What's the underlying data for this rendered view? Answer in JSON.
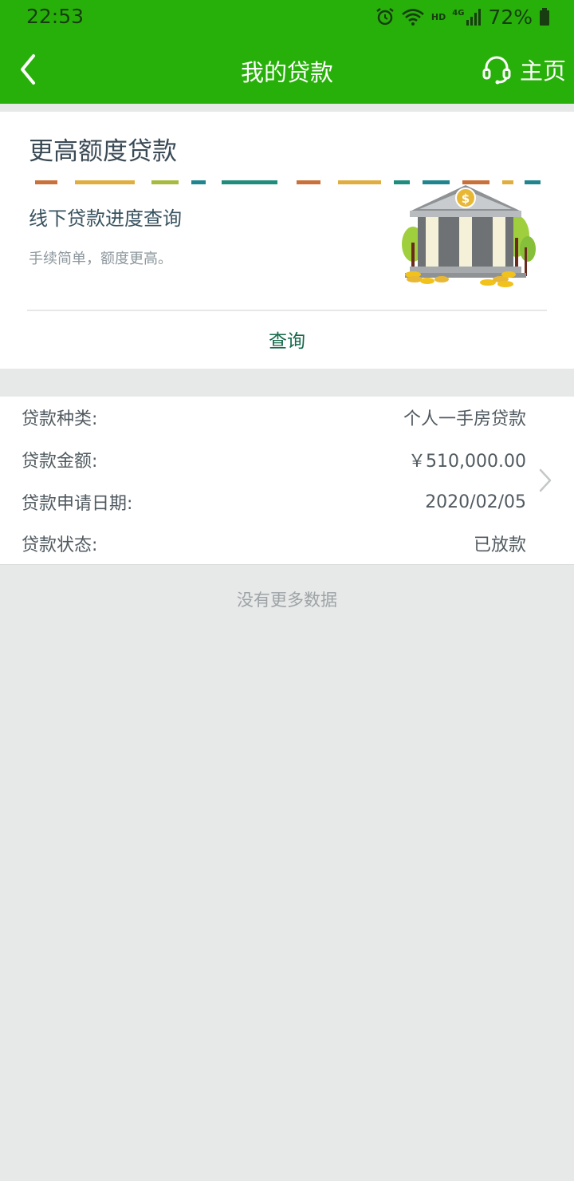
{
  "status_bar": {
    "time": "22:53",
    "hd": "HD",
    "network": "4G",
    "battery_percent": "72%"
  },
  "header": {
    "title": "我的贷款",
    "home_label": "主页",
    "icons": {
      "back": "chevron-left-icon",
      "service": "headset-icon"
    }
  },
  "promo": {
    "title": "更高额度贷款",
    "subtitle": "线下贷款进度查询",
    "description": "手续简单，额度更高。",
    "query_label": "查询",
    "illustration": "bank-building-with-coins"
  },
  "loan": {
    "rows": [
      {
        "label": "贷款种类:",
        "value": "个人一手房贷款"
      },
      {
        "label": "贷款金额:",
        "value": "￥510,000.00"
      },
      {
        "label": "贷款申请日期:",
        "value": "2020/02/05"
      },
      {
        "label": "贷款状态:",
        "value": "已放款"
      }
    ]
  },
  "footer": {
    "no_more": "没有更多数据"
  },
  "colors": {
    "header_green": "#28b00a",
    "query_green": "#14684a",
    "page_bg": "#e7e8e8"
  }
}
